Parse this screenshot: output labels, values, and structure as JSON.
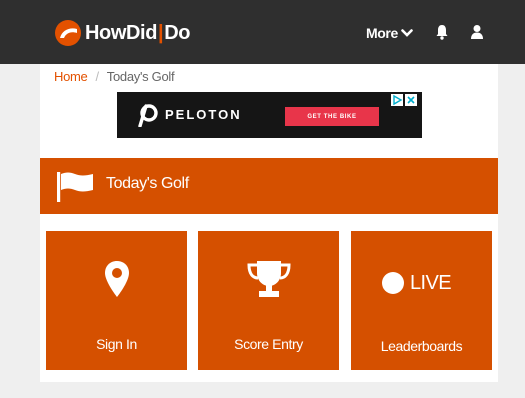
{
  "header": {
    "brand": {
      "part1": "HowDid",
      "separator": "|",
      "part2": "Do"
    },
    "more_label": "More",
    "bell_icon": "bell-icon",
    "user_icon": "user-icon"
  },
  "breadcrumb": {
    "home": "Home",
    "separator": "/",
    "current": "Today's Golf"
  },
  "ad": {
    "brand": "PELOTON",
    "cta": "GET THE BIKE"
  },
  "banner": {
    "title": "Today's Golf",
    "icon": "flag-icon"
  },
  "tiles": [
    {
      "label": "Sign In",
      "icon": "map-pin-icon"
    },
    {
      "label": "Score Entry",
      "icon": "trophy-icon"
    },
    {
      "label": "Leaderboards",
      "icon": "live-dot-icon",
      "badge": "LIVE"
    }
  ],
  "colors": {
    "accent": "#d55000",
    "header_bg": "#2f2f2f",
    "link": "#e35100",
    "page_bg": "#efefef",
    "ad_cta": "#e8354a"
  }
}
